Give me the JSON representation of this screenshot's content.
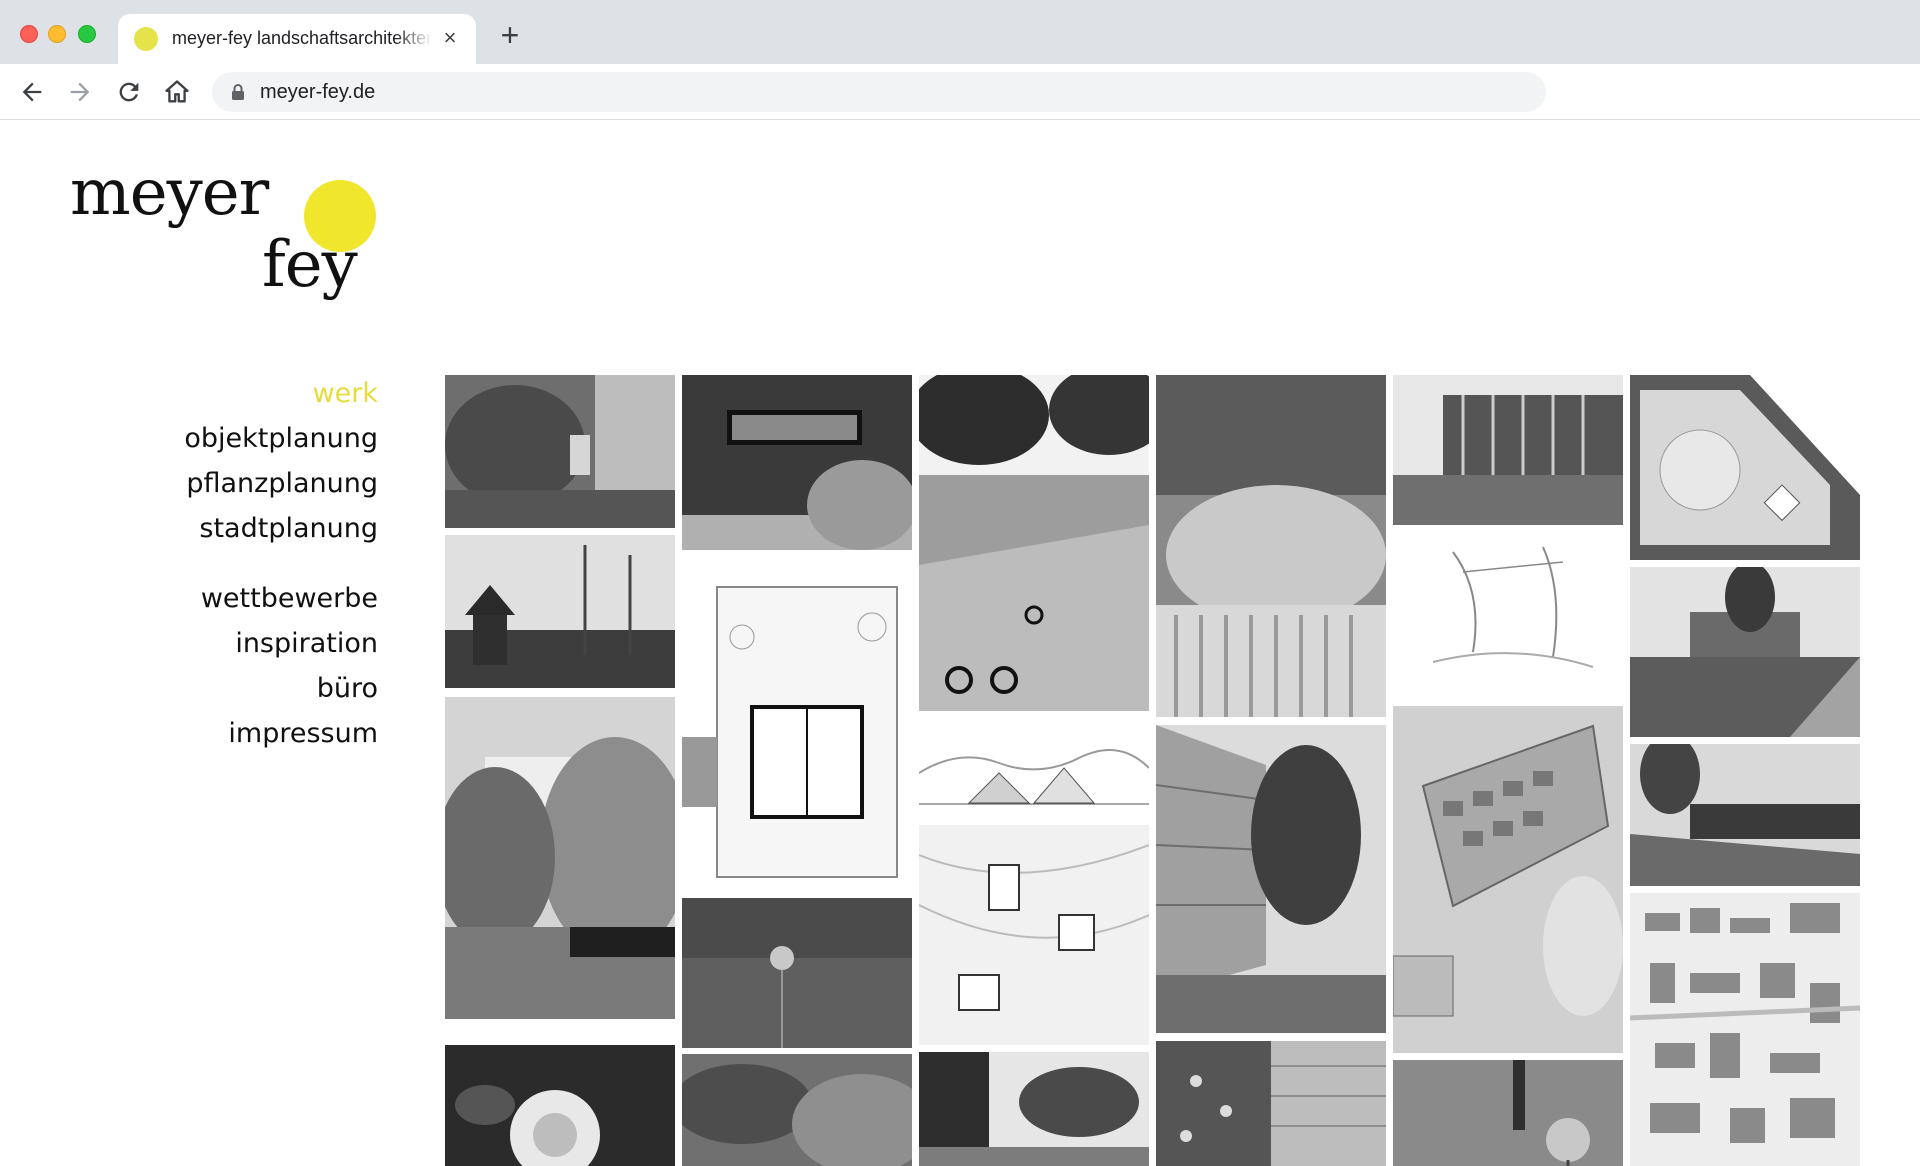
{
  "browser": {
    "tab": {
      "title": "meyer-fey landschaftsarchitekten",
      "close_symbol": "×",
      "favicon_color": "#e5e34a"
    },
    "new_tab_symbol": "+",
    "address_bar": {
      "url": "meyer-fey.de"
    },
    "icons": [
      "back-arrow-icon",
      "forward-arrow-icon",
      "reload-icon",
      "home-icon",
      "lock-icon"
    ]
  },
  "site": {
    "logo": {
      "line1": "meyer",
      "line2": "fey",
      "dot_color": "#f0e62c"
    },
    "accent_color": "#e6dc3c",
    "nav": {
      "primary": [
        {
          "label": "werk",
          "active": true
        },
        {
          "label": "objektplanung",
          "active": false
        },
        {
          "label": "pflanzplanung",
          "active": false
        },
        {
          "label": "stadtplanung",
          "active": false
        }
      ],
      "secondary": [
        {
          "label": "wettbewerbe",
          "active": false
        },
        {
          "label": "inspiration",
          "active": false
        },
        {
          "label": "büro",
          "active": false
        },
        {
          "label": "impressum",
          "active": false
        }
      ]
    }
  }
}
